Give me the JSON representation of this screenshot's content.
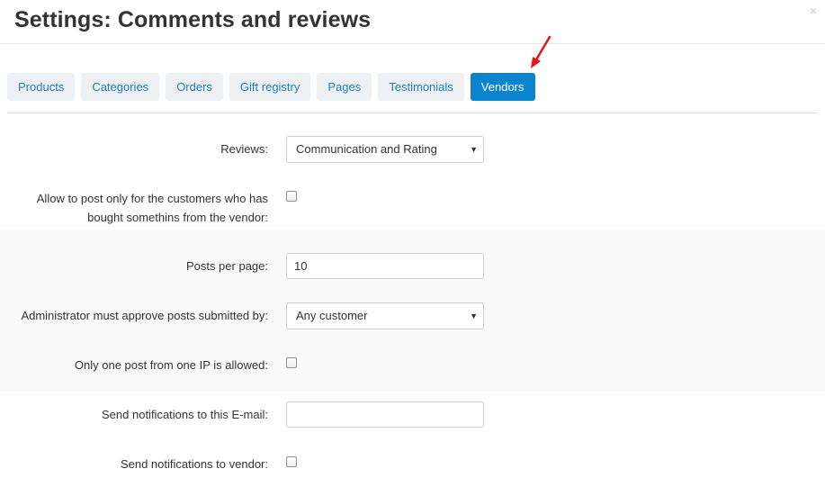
{
  "dialog": {
    "title": "Settings: Comments and reviews",
    "close_symbol": "×"
  },
  "tabs": [
    {
      "label": "Products",
      "active": false
    },
    {
      "label": "Categories",
      "active": false
    },
    {
      "label": "Orders",
      "active": false
    },
    {
      "label": "Gift registry",
      "active": false
    },
    {
      "label": "Pages",
      "active": false
    },
    {
      "label": "Testimonials",
      "active": false
    },
    {
      "label": "Vendors",
      "active": true
    }
  ],
  "form": {
    "reviews": {
      "label": "Reviews:",
      "value": "Communication and Rating"
    },
    "allow_post": {
      "label_line1": "Allow to post only for the customers who has",
      "label_line2": "bought somethins from the vendor:",
      "checked": false
    },
    "posts_per_page": {
      "label": "Posts per page:",
      "value": "10"
    },
    "admin_approve": {
      "label": "Administrator must approve posts submitted by:",
      "value": "Any customer"
    },
    "one_post_ip": {
      "label": "Only one post from one IP is allowed:",
      "checked": false
    },
    "notify_email": {
      "label": "Send notifications to this E-mail:",
      "value": ""
    },
    "notify_vendor": {
      "label": "Send notifications to vendor:",
      "checked": false
    }
  },
  "colors": {
    "accent": "#0b84cf",
    "tab_text": "#1f7cbf",
    "tab_bg": "#eef1f3",
    "arrow": "#e3161b"
  },
  "icons": {
    "close": "close-icon",
    "dropdown": "chevron-down-icon",
    "annotation": "red-arrow-icon"
  }
}
